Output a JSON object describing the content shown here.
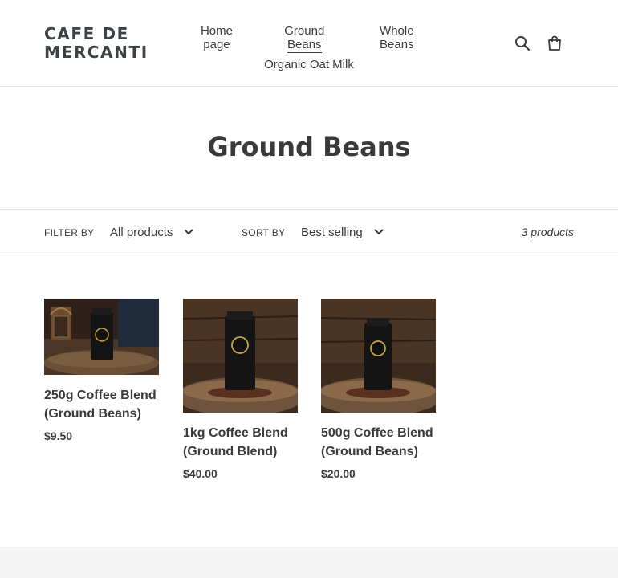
{
  "store": {
    "name": "CAFE DE MERCANTI"
  },
  "nav": {
    "items": [
      {
        "label": "Home page"
      },
      {
        "label": "Ground Beans"
      },
      {
        "label": "Whole Beans"
      },
      {
        "label": "Organic Oat Milk"
      }
    ],
    "active": "Ground Beans"
  },
  "icons": {
    "search": "search-icon",
    "cart": "cart-icon"
  },
  "collection": {
    "title": "Ground Beans",
    "filter_label": "Filter by",
    "filter_value": "All products",
    "sort_label": "Sort by",
    "sort_value": "Best selling",
    "product_count": "3 products"
  },
  "products": [
    {
      "name": "250g Coffee Blend (Ground Beans)",
      "price": "$9.50"
    },
    {
      "name": "1kg Coffee Blend (Ground Blend)",
      "price": "$40.00"
    },
    {
      "name": "500g Coffee Blend (Ground Beans)",
      "price": "$20.00"
    }
  ],
  "colors": {
    "text": "#3a3a3a",
    "border": "#e8e8e1",
    "footer_bg": "#f5f5f5",
    "accent_gold": "#c9a43a"
  }
}
